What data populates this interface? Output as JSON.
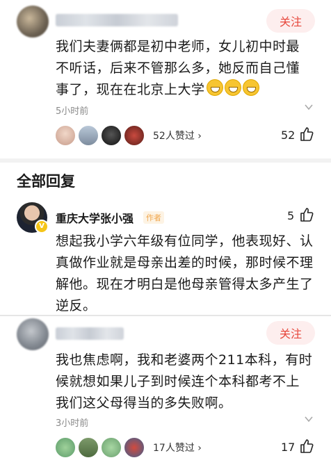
{
  "comment1": {
    "follow_label": "关注",
    "text": "我们夫妻俩都是初中老师，女儿初中时最不听话，后来不管那么多，她反而自己懂事了，现在在北京上大学",
    "time": "5小时前",
    "likers_text": "52人赞过 ›",
    "like_count": "52"
  },
  "section_title": "全部回复",
  "reply": {
    "author": "重庆大学张小强",
    "author_badge": "作者",
    "like_count": "5",
    "text": "想起我小学六年级有位同学，他表现好、认真做作业就是母亲出差的时候，那时候不理解他。现在才明白是他母亲管得太多产生了逆反。"
  },
  "comment2": {
    "follow_label": "关注",
    "text": "我也焦虑啊，我和老婆两个211本科，有时候就想如果儿子到时候连个本科都考不上我们这父母得当的多失败啊。",
    "time": "3小时前",
    "likers_text": "17人赞过 ›",
    "like_count": "17"
  },
  "colors": {
    "accent": "#e7473c",
    "follow_bg": "#fdeeee",
    "badge": "#f0a64c"
  },
  "icons": [
    "chevron-down-icon",
    "thumbs-up-icon",
    "emoji-grin-icon",
    "verified-badge-icon"
  ]
}
